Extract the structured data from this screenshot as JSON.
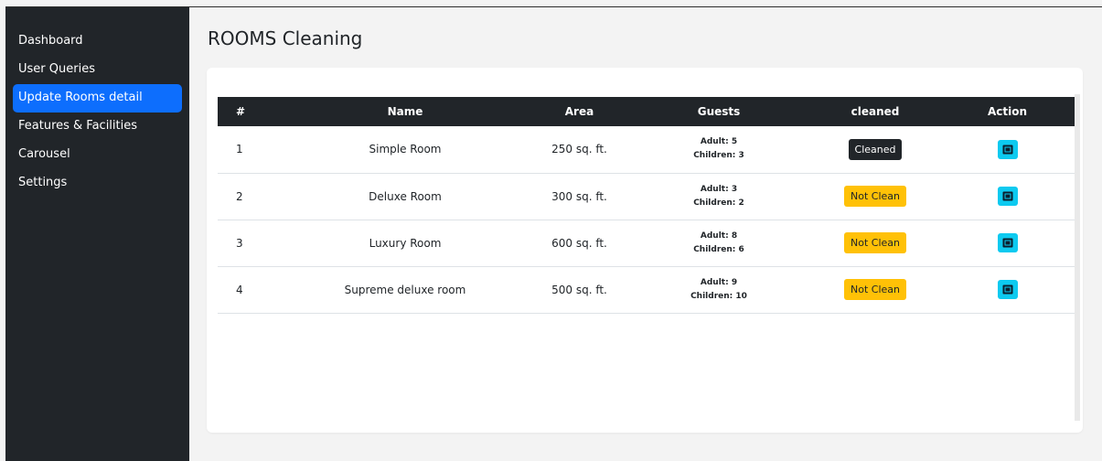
{
  "sidebar": {
    "items": [
      {
        "label": "Dashboard",
        "active": false
      },
      {
        "label": "User Queries",
        "active": false
      },
      {
        "label": "Update Rooms detail",
        "active": true
      },
      {
        "label": "Features & Facilities",
        "active": false
      },
      {
        "label": "Carousel",
        "active": false
      },
      {
        "label": "Settings",
        "active": false
      }
    ]
  },
  "page": {
    "title": "ROOMS Cleaning"
  },
  "table": {
    "headers": [
      "#",
      "Name",
      "Area",
      "Guests",
      "cleaned",
      "Action"
    ],
    "rows": [
      {
        "num": "1",
        "name": "Simple Room",
        "area": "250 sq. ft.",
        "adult": "Adult: 5",
        "children": "Children: 3",
        "status": "Cleaned"
      },
      {
        "num": "2",
        "name": "Deluxe Room",
        "area": "300 sq. ft.",
        "adult": "Adult: 3",
        "children": "Children: 2",
        "status": "Not Clean"
      },
      {
        "num": "3",
        "name": "Luxury Room",
        "area": "600 sq. ft.",
        "adult": "Adult: 8",
        "children": "Children: 6",
        "status": "Not Clean"
      },
      {
        "num": "4",
        "name": "Supreme deluxe room",
        "area": "500 sq. ft.",
        "adult": "Adult: 9",
        "children": "Children: 10",
        "status": "Not Clean"
      }
    ]
  },
  "icons": {
    "action": "edit-icon"
  },
  "colors": {
    "sidebar": "#212529",
    "active": "#0d6efd",
    "warning": "#ffc107",
    "info": "#0dcaf0",
    "dark": "#212529"
  }
}
